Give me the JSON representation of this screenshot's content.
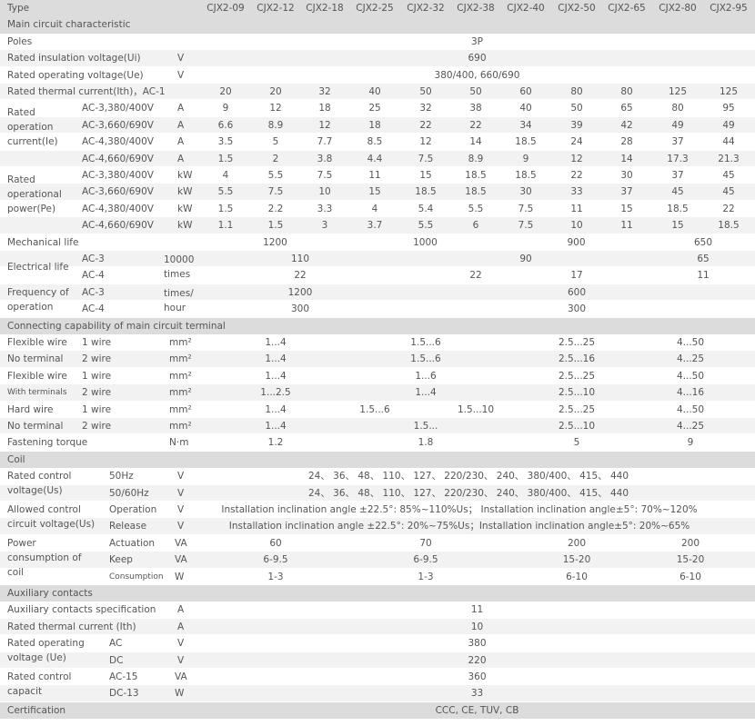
{
  "title": "Type",
  "models": [
    "CJX2-09",
    "CJX2-12",
    "CJX2-18",
    "CJX2-25",
    "CJX2-32",
    "CJX2-38",
    "CJX2-40",
    "CJX2-50",
    "CJX2-65",
    "CJX2-80",
    "CJX2-95"
  ],
  "sections": {
    "main": "Main circuit characteristic",
    "connecting": "Connecting capability of main circuit terminal",
    "coil": "Coil",
    "aux": "Auxiliary contacts",
    "cert": "Certification"
  },
  "main": {
    "poles_label": "Poles",
    "poles_value": "3P",
    "ui_label": "Rated insulation voltage(Ui)",
    "ui_unit": "V",
    "ui_value": "690",
    "ue_label": "Rated operating voltage(Ue)",
    "ue_unit": "V",
    "ue_value": "380/400, 660/690",
    "ith_label": "Rated thermal current(Ith)，AC-1",
    "ith_values": [
      "20",
      "20",
      "32",
      "40",
      "50",
      "50",
      "60",
      "80",
      "80",
      "125",
      "125"
    ],
    "ie_label": "Rated operation current(Ie)",
    "ie_rows": [
      {
        "cat": "AC-3,380/400V",
        "unit": "A",
        "values": [
          "9",
          "12",
          "18",
          "25",
          "32",
          "38",
          "40",
          "50",
          "65",
          "80",
          "95"
        ]
      },
      {
        "cat": "AC-3,660/690V",
        "unit": "A",
        "values": [
          "6.6",
          "8.9",
          "12",
          "18",
          "22",
          "22",
          "34",
          "39",
          "42",
          "49",
          "49"
        ]
      },
      {
        "cat": "AC-4,380/400V",
        "unit": "A",
        "values": [
          "3.5",
          "5",
          "7.7",
          "8.5",
          "12",
          "14",
          "18.5",
          "24",
          "28",
          "37",
          "44"
        ]
      },
      {
        "cat": "AC-4,660/690V",
        "unit": "A",
        "values": [
          "1.5",
          "2",
          "3.8",
          "4.4",
          "7.5",
          "8.9",
          "9",
          "12",
          "14",
          "17.3",
          "21.3"
        ]
      }
    ],
    "pe_label": "Rated operational power(Pe)",
    "pe_rows": [
      {
        "cat": "AC-3,380/400V",
        "unit": "kW",
        "values": [
          "4",
          "5.5",
          "7.5",
          "11",
          "15",
          "18.5",
          "18.5",
          "22",
          "30",
          "37",
          "45"
        ]
      },
      {
        "cat": "AC-3,660/690V",
        "unit": "kW",
        "values": [
          "5.5",
          "7.5",
          "10",
          "15",
          "18.5",
          "18.5",
          "30",
          "33",
          "37",
          "45",
          "45"
        ]
      },
      {
        "cat": "AC-4,380/400V",
        "unit": "kW",
        "values": [
          "1.5",
          "2.2",
          "3.3",
          "4",
          "5.4",
          "5.5",
          "7.5",
          "11",
          "15",
          "18.5",
          "22"
        ]
      },
      {
        "cat": "AC-4,660/690V",
        "unit": "kW",
        "values": [
          "1.1",
          "1.5",
          "3",
          "3.7",
          "5.5",
          "6",
          "7.5",
          "10",
          "11",
          "15",
          "18.5"
        ]
      }
    ],
    "mech_label": "Mechanical life",
    "mech_values": [
      "1200",
      "1000",
      "900",
      "650"
    ],
    "elec_label": "Electrical life",
    "elec_unit": "10000 times",
    "elec_ac3": "AC-3",
    "elec_ac3_values": [
      "110",
      "90",
      "65"
    ],
    "elec_ac4": "AC-4",
    "elec_ac4_values": [
      "22",
      "22",
      "17",
      "11"
    ],
    "freq_label": "Frequency of operation",
    "freq_unit": "times/ hour",
    "freq_ac3": "AC-3",
    "freq_ac3_values": [
      "1200",
      "600"
    ],
    "freq_ac4": "AC-4",
    "freq_ac4_values": [
      "300",
      "300"
    ]
  },
  "connecting": {
    "rows": [
      {
        "label": "Flexible wire",
        "wire": "1 wire",
        "unit": "mm²",
        "values": [
          "1...4",
          "1.5...6",
          "2.5...25",
          "4...50"
        ]
      },
      {
        "label": "No terminal",
        "wire": "2 wire",
        "unit": "mm²",
        "values": [
          "1...4",
          "1.5...6",
          "2.5...16",
          "4...25"
        ]
      },
      {
        "label": "Flexible wire",
        "wire": "1 wire",
        "unit": "mm²",
        "values": [
          "1...4",
          "1...6",
          "2.5...25",
          "4...50"
        ]
      },
      {
        "label": "With terminals",
        "wire": "2 wire",
        "unit": "mm²",
        "values": [
          "1...2.5",
          "1...4",
          "2.5...10",
          "4...16"
        ]
      },
      {
        "label": "Hard wire",
        "wire": "1 wire",
        "unit": "mm²",
        "values": [
          "1...4",
          "1.5...6",
          "1.5...10",
          "2.5...25",
          "4...50"
        ]
      },
      {
        "label": "No terminal",
        "wire": "2 wire",
        "unit": "mm²",
        "values": [
          "1...4",
          "1.5...",
          "2.5...10",
          "4...25"
        ]
      }
    ],
    "torque_label": "Fastening torque",
    "torque_unit": "N·m",
    "torque_values": [
      "1.2",
      "1.8",
      "5",
      "9"
    ]
  },
  "coil": {
    "us_label": "Rated control voltage(Us)",
    "us_rows": [
      {
        "freq": "50Hz",
        "unit": "V",
        "value": "24、 36、 48、 110、 127、 220/230、 240、 380/400、 415、 440"
      },
      {
        "freq": "50/60Hz",
        "unit": "V",
        "value": "24、 36、 48、 110、 127、 220/230、 240、 380/400、 415、 440"
      }
    ],
    "allowed_label": "Allowed control circuit voltage(Us)",
    "allowed_rows": [
      {
        "op": "Operation",
        "unit": "V",
        "value": "Installation inclination angle ±22.5°: 85%~110%Us； Installation inclination angle±5°: 70%~120%"
      },
      {
        "op": "Release",
        "unit": "V",
        "value": "Installation inclination angle ±22.5°: 20%~75%Us；Installation inclination angle±5°: 20%~65%"
      }
    ],
    "power_label": "Power consumption of coil",
    "power_rows": [
      {
        "type": "Actuation",
        "unit": "VA",
        "values": [
          "60",
          "70",
          "200",
          "200"
        ]
      },
      {
        "type": "Keep",
        "unit": "VA",
        "values": [
          "6-9.5",
          "6-9.5",
          "15-20",
          "15-20"
        ]
      },
      {
        "type": "Consumption",
        "unit": "W",
        "values": [
          "1-3",
          "1-3",
          "6-10",
          "6-10"
        ]
      }
    ]
  },
  "aux": {
    "spec_label": "Auxiliary contacts specification",
    "spec_unit": "A",
    "spec_value": "11",
    "ith_label": "Rated thermal current (Ith)",
    "ith_unit": "A",
    "ith_value": "10",
    "ue_label": "Rated operating voltage (Ue)",
    "ue_rows": [
      {
        "type": "AC",
        "unit": "V",
        "value": "380"
      },
      {
        "type": "DC",
        "unit": "V",
        "value": "220"
      }
    ],
    "cap_label": "Rated control capacit",
    "cap_rows": [
      {
        "type": "AC-15",
        "unit": "VA",
        "value": "360"
      },
      {
        "type": "DC-13",
        "unit": "W",
        "value": "33"
      }
    ]
  },
  "certification": "CCC, CE, TUV, CB"
}
